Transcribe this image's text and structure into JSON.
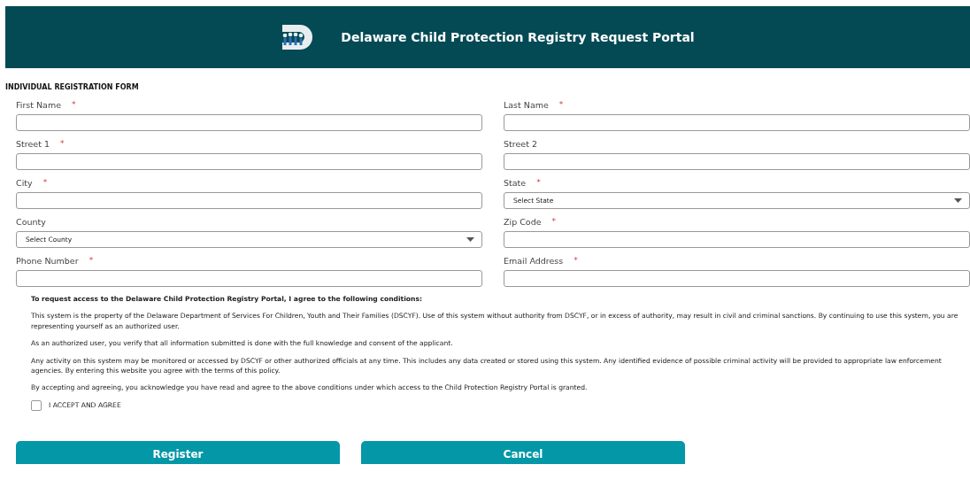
{
  "header": {
    "title": "Delaware Child Protection Registry Request Portal"
  },
  "form_title": "INDIVIDUAL REGISTRATION FORM",
  "fields": [
    {
      "label": "First Name",
      "required": true,
      "kind": "text"
    },
    {
      "label": "Last Name",
      "required": true,
      "kind": "text"
    },
    {
      "label": "Street 1",
      "required": true,
      "kind": "text"
    },
    {
      "label": "Street 2",
      "required": false,
      "kind": "text"
    },
    {
      "label": "City",
      "required": true,
      "kind": "text"
    },
    {
      "label": "State",
      "required": true,
      "kind": "select",
      "value": "Select State"
    },
    {
      "label": "County",
      "required": false,
      "kind": "select",
      "value": "Select County"
    },
    {
      "label": "Zip Code",
      "required": true,
      "kind": "text"
    },
    {
      "label": "Phone Number",
      "required": true,
      "kind": "text"
    },
    {
      "label": "Email Address",
      "required": true,
      "kind": "text"
    }
  ],
  "required_mark": "*",
  "terms": {
    "heading": "To request access to the Delaware Child Protection Registry Portal, I agree to the following conditions:",
    "paragraphs": [
      "This system is the property of the Delaware Department of Services For Children, Youth and Their Families (DSCYF). Use of this system without authority from DSCYF, or in excess of authority, may result in civil and criminal sanctions. By continuing to use this system, you are representing yourself as an authorized user.",
      "As an authorized user, you verify that all information submitted is done with the full knowledge and consent of the applicant.",
      "Any activity on this system may be monitored or accessed by DSCYF or other authorized officials at any time. This includes any data created or stored using this system. Any identified evidence of possible criminal activity will be provided to appropriate law enforcement agencies. By entering this website you agree with the terms of this policy.",
      "By accepting and agreeing, you acknowledge you have read and agree to the above conditions under which access to the Child Protection Registry Portal is granted."
    ]
  },
  "accept": {
    "label": "I ACCEPT AND AGREE",
    "checked": false
  },
  "buttons": [
    "Register",
    "Cancel"
  ]
}
